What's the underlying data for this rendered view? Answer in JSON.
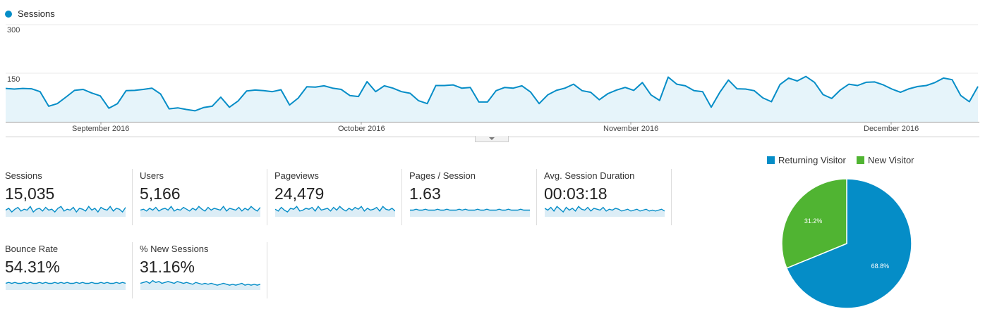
{
  "legend": {
    "series_label": "Sessions",
    "series_color": "#058dc7"
  },
  "chart_data": [
    {
      "type": "area",
      "series": [
        {
          "name": "Sessions",
          "values": [
            103,
            101,
            103,
            102,
            93,
            48,
            56,
            76,
            97,
            100,
            89,
            80,
            42,
            56,
            96,
            97,
            100,
            104,
            86,
            40,
            43,
            38,
            34,
            44,
            48,
            76,
            45,
            64,
            95,
            98,
            96,
            93,
            99,
            52,
            73,
            108,
            107,
            111,
            104,
            100,
            81,
            78,
            124,
            93,
            111,
            104,
            93,
            88,
            65,
            56,
            112,
            112,
            114,
            104,
            106,
            61,
            61,
            96,
            106,
            104,
            111,
            92,
            56,
            83,
            97,
            104,
            116,
            96,
            91,
            68,
            87,
            98,
            106,
            97,
            121,
            83,
            66,
            138,
            116,
            111,
            96,
            93,
            45,
            91,
            129,
            102,
            101,
            96,
            74,
            62,
            115,
            135,
            126,
            140,
            122,
            84,
            72,
            98,
            116,
            112,
            122,
            123,
            114,
            101,
            91,
            102,
            109,
            112,
            121,
            135,
            130,
            81,
            62,
            109
          ]
        }
      ],
      "x_axis_labels": [
        "September 2016",
        "October 2016",
        "November 2016",
        "December 2016"
      ],
      "y_axis_labels": [
        "300",
        "150"
      ],
      "ylim": [
        0,
        300
      ],
      "grid": true
    },
    {
      "type": "pie",
      "categories": [
        "Returning Visitor",
        "New Visitor"
      ],
      "values": [
        68.8,
        31.2
      ],
      "colors": [
        "#058dc7",
        "#50b432"
      ],
      "labels": [
        "68.8%",
        "31.2%"
      ]
    }
  ],
  "metrics": [
    {
      "name": "Sessions",
      "value": "15,035",
      "spark": [
        5,
        7,
        3,
        6,
        8,
        4,
        6,
        5,
        9,
        3,
        6,
        7,
        4,
        8,
        5,
        6,
        3,
        7,
        9,
        4,
        6,
        5,
        8,
        3,
        7,
        6,
        4,
        9,
        5,
        7,
        3,
        8,
        6,
        5,
        9,
        4,
        7,
        6,
        3,
        8
      ],
      "fill": true
    },
    {
      "name": "Users",
      "value": "5,166",
      "spark": [
        5,
        6,
        4,
        7,
        5,
        8,
        4,
        6,
        7,
        5,
        9,
        4,
        6,
        5,
        8,
        6,
        4,
        7,
        5,
        9,
        6,
        4,
        8,
        5,
        7,
        6,
        5,
        9,
        4,
        7,
        6,
        5,
        8,
        4,
        7,
        5,
        9,
        6,
        4,
        8
      ],
      "fill": true
    },
    {
      "name": "Pageviews",
      "value": "24,479",
      "spark": [
        6,
        4,
        8,
        5,
        3,
        7,
        6,
        9,
        4,
        5,
        7,
        6,
        8,
        4,
        9,
        5,
        6,
        7,
        4,
        8,
        5,
        9,
        6,
        4,
        7,
        5,
        8,
        6,
        9,
        4,
        7,
        5,
        6,
        8,
        4,
        9,
        6,
        5,
        7,
        4
      ],
      "fill": true
    },
    {
      "name": "Pages / Session",
      "value": "1.63",
      "spark": [
        5,
        5,
        6,
        5,
        5,
        6,
        5,
        5,
        5,
        6,
        5,
        5,
        6,
        5,
        5,
        5,
        6,
        5,
        6,
        5,
        5,
        5,
        6,
        5,
        5,
        6,
        5,
        5,
        5,
        6,
        5,
        5,
        6,
        5,
        5,
        5,
        6,
        5,
        5,
        5
      ],
      "fill": true
    },
    {
      "name": "Avg. Session Duration",
      "value": "00:03:18",
      "spark": [
        7,
        5,
        8,
        4,
        9,
        6,
        3,
        8,
        5,
        7,
        4,
        9,
        6,
        5,
        8,
        4,
        7,
        6,
        5,
        8,
        4,
        6,
        5,
        7,
        6,
        4,
        5,
        6,
        4,
        5,
        6,
        4,
        5,
        6,
        4,
        5,
        4,
        5,
        6,
        4
      ],
      "fill": true
    },
    {
      "name": "Bounce Rate",
      "value": "54.31%",
      "spark": [
        5,
        6,
        5,
        6,
        5,
        5,
        6,
        5,
        6,
        5,
        5,
        6,
        5,
        6,
        5,
        5,
        6,
        5,
        6,
        5,
        6,
        5,
        5,
        6,
        5,
        6,
        5,
        5,
        6,
        5,
        5,
        6,
        5,
        6,
        5,
        5,
        6,
        5,
        6,
        5
      ],
      "fill": true
    },
    {
      "name": "% New Sessions",
      "value": "31.16%",
      "spark": [
        5,
        6,
        7,
        5,
        8,
        6,
        7,
        5,
        6,
        7,
        6,
        5,
        7,
        6,
        5,
        6,
        5,
        4,
        6,
        5,
        4,
        5,
        4,
        5,
        4,
        3,
        4,
        5,
        4,
        3,
        4,
        3,
        4,
        5,
        3,
        4,
        3,
        4,
        3,
        4
      ],
      "fill": true
    }
  ]
}
